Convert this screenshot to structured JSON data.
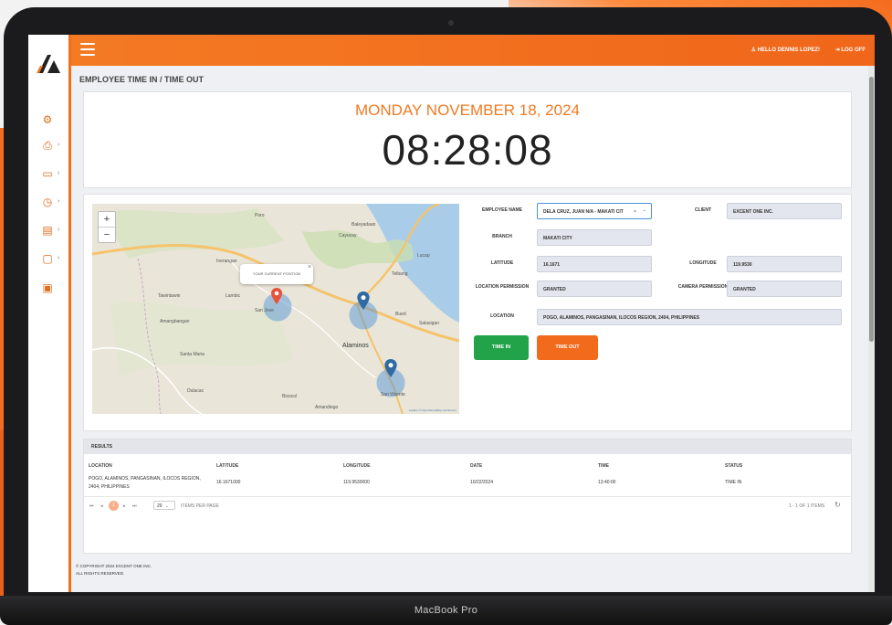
{
  "device": {
    "model_label": "MacBook Pro"
  },
  "topbar": {
    "user_label": "HELLO DENNIS LOPEZ!",
    "logout_label": "LOG OFF"
  },
  "page": {
    "title": "EMPLOYEE TIME IN / TIME OUT"
  },
  "clock": {
    "date": "MONDAY NOVEMBER 18, 2024",
    "time": "08:28:08"
  },
  "map": {
    "popup_text": "YOUR CURRENT POSITION",
    "popup_close": "×",
    "zoom_in": "+",
    "zoom_out": "−",
    "places": [
      "Poro",
      "Baleyadaan",
      "Cayucay",
      "Lucap",
      "Inerangan",
      "Telbang",
      "Tawintawin",
      "Lambic",
      "San Jose",
      "Amangbangan",
      "Alaminos",
      "Bued",
      "Salasigan",
      "Santa Maria",
      "Dulacac",
      "Bisocol",
      "San Vicente",
      "Amandiego"
    ],
    "attribution": "Leaflet | © OpenStreetMap contributors",
    "accent_color": "#4a90d9",
    "marker_color": "#2f6aa3",
    "current_marker_color": "#e8523a"
  },
  "form": {
    "employee_name_label": "EMPLOYEE NAME",
    "employee_name_value": "DELA CRUZ, JUAN N/A - MAKATI CIT",
    "employee_clear": "×",
    "employee_caret": "⌄",
    "client_label": "CLIENT",
    "client_value": "EXCENT ONE INC.",
    "branch_label": "BRANCH",
    "branch_value": "MAKATI CITY",
    "latitude_label": "LATITUDE",
    "latitude_value": "16.1671",
    "longitude_label": "LONGITUDE",
    "longitude_value": "119.9530",
    "location_permission_label": "LOCATION PERMISSION",
    "location_permission_value": "GRANTED",
    "camera_permission_label": "CAMERA PERMISSION",
    "camera_permission_value": "GRANTED",
    "location_label": "LOCATION",
    "location_value": "POGO, ALAMINOS, PANGASINAN, ILOCOS REGION, 2404, PHILIPPINES",
    "time_in_label": "TIME IN",
    "time_out_label": "TIME OUT",
    "time_in_color": "#22a34a",
    "time_out_color": "#f26b1d"
  },
  "results": {
    "header": "RESULTS",
    "columns": [
      "LOCATION",
      "LATITUDE",
      "LONGITUDE",
      "DATE",
      "TIME",
      "STATUS"
    ],
    "rows": [
      [
        "POGO, ALAMINOS, PANGASINAN, ILOCOS REGION, 2404, PHILIPPINES",
        "16.1671000",
        "119.9530000",
        "10/22/2024",
        "13:40:00",
        "TIME IN"
      ]
    ],
    "pager": {
      "current_page": "1",
      "page_size": "20",
      "page_size_label": "ITEMS PER PAGE",
      "summary": "1 - 1 OF 1 ITEMS"
    }
  },
  "footer": {
    "line1": "© COPYRIGHT 2024 EXCENT ONE INC.",
    "line2": "ALL RIGHTS RESERVED."
  }
}
